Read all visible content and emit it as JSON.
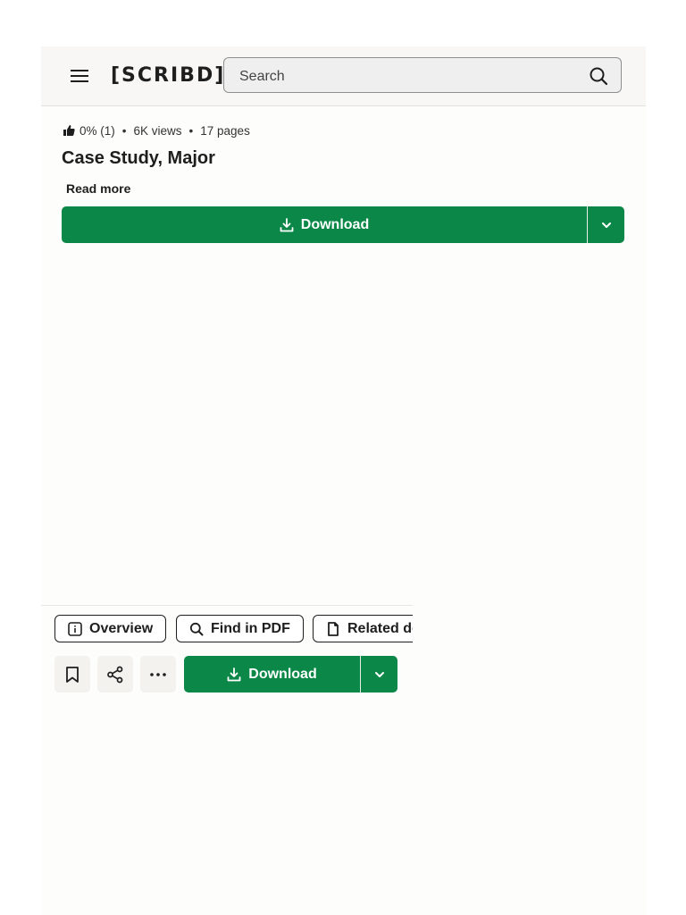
{
  "header": {
    "logo": "[SCRIBD]",
    "search_placeholder": "Search",
    "icons": {
      "menu": "hamburger-menu-icon",
      "search": "search-icon"
    }
  },
  "document": {
    "rating": "0% (1)",
    "views": "6K views",
    "pages": "17 pages",
    "separator": "•",
    "title": "Case Study, Major",
    "read_more": "Read more"
  },
  "actions": {
    "download_label": "Download"
  },
  "bottom_bar": {
    "tabs": [
      {
        "label": "Overview",
        "icon": "info-icon"
      },
      {
        "label": "Find in PDF",
        "icon": "search-icon"
      },
      {
        "label": "Related documents",
        "icon": "document-icon"
      }
    ],
    "icon_buttons": [
      "bookmark-icon",
      "share-icon",
      "more-icon"
    ],
    "download_label": "Download"
  },
  "colors": {
    "accent_green": "#0b8848",
    "header_bg": "#f8f7f5",
    "text": "#1e1e1e"
  }
}
